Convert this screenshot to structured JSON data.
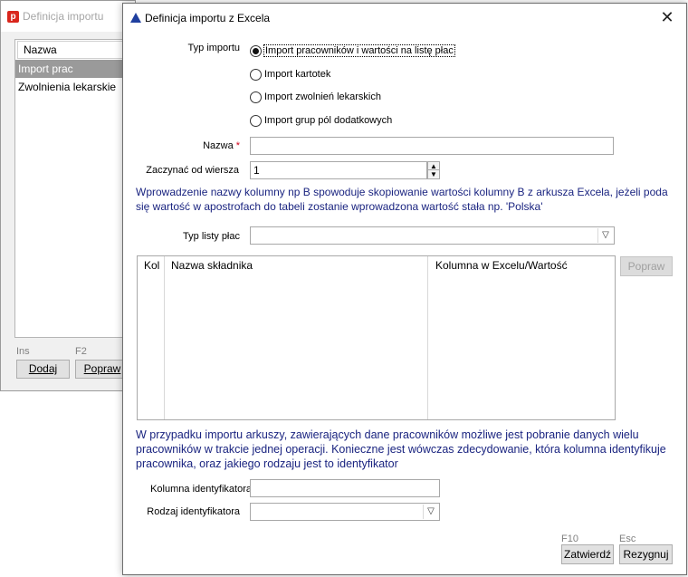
{
  "background_window": {
    "title": "Definicja importu",
    "app_icon_letter": "p",
    "list_header": "Nazwa",
    "rows": [
      "Import prac",
      "Zwolnienia lekarskie"
    ],
    "key_add": "Ins",
    "key_edit": "F2",
    "add_label": "Dodaj",
    "edit_label": "Popraw"
  },
  "dialog": {
    "title": "Definicja importu z Excela",
    "close_glyph": "✕",
    "import_type_label": "Typ importu",
    "import_options": [
      "Import pracowników i wartości na listę płac",
      "Import kartotek",
      "Import zwolnień lekarskich",
      "Import grup pól dodatkowych"
    ],
    "selected_option_index": 0,
    "name_label": "Nazwa",
    "required_mark": "*",
    "name_value": "",
    "start_row_label": "Zaczynać od wiersza",
    "start_row_value": "1",
    "info_text_1": "Wprowadzenie nazwy kolumny np B spowoduje skopiowanie wartości kolumny B z arkusza Excela, jeżeli poda się wartość w apostrofach do tabeli zostanie wprowadzona wartość stała np. 'Polska'",
    "payroll_type_label": "Typ listy płac",
    "payroll_type_value": "",
    "grid_headers": [
      "Kol",
      "Nazwa składnika",
      "Kolumna w Excelu/Wartość"
    ],
    "grid_edit_label": "Popraw",
    "info_text_2": "W przypadku importu arkuszy, zawierających dane pracowników możliwe jest pobranie danych wielu pracowników w trakcie jednej operacji. Konieczne jest wówczas zdecydowanie, która kolumna identyfikuje pracownika, oraz jakiego rodzaju jest to identyfikator",
    "id_column_label": "Kolumna identyfikatora",
    "id_column_value": "",
    "id_type_label": "Rodzaj identyfikatora",
    "id_type_value": "",
    "confirm_key": "F10",
    "confirm_label": "Zatwierdź",
    "cancel_key": "Esc",
    "cancel_label": "Rezygnuj"
  },
  "colors": {
    "info_text": "#1a2480",
    "title_icon": "#1f3f9f",
    "app_icon": "#d9261c",
    "selected_row": "#9a9a9a"
  },
  "icons": {
    "app": "app-logo-icon",
    "dialog": "triangle-app-icon",
    "close": "close-icon",
    "dropdown": "chevron-down-icon",
    "spin_up": "arrow-up-icon",
    "spin_down": "arrow-down-icon"
  }
}
